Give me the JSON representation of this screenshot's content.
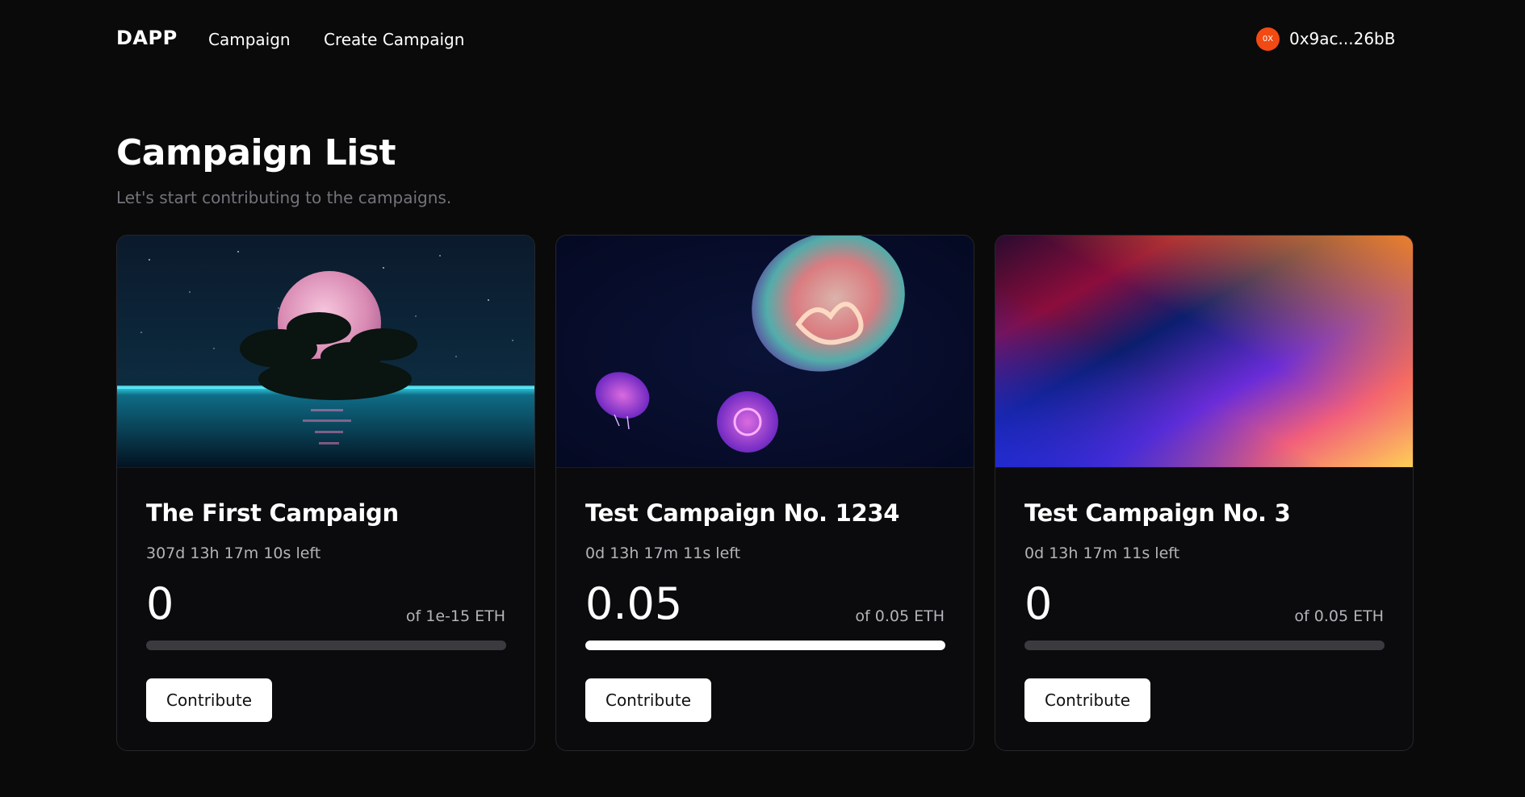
{
  "nav": {
    "brand": "DAPP",
    "links": [
      "Campaign",
      "Create Campaign"
    ],
    "wallet": {
      "avatar_text": "0X",
      "address": "0x9ac...26bB",
      "avatar_color": "#f24a12"
    }
  },
  "page": {
    "title": "Campaign List",
    "subtitle": "Let's start contributing to the campaigns."
  },
  "campaigns": [
    {
      "title": "The First Campaign",
      "time_left": "307d 13h 17m 10s left",
      "raised": "0",
      "goal": "of 1e-15 ETH",
      "progress": 0,
      "button": "Contribute",
      "image": "moon-island-image"
    },
    {
      "title": "Test Campaign No. 1234",
      "time_left": "0d 13h 17m 11s left",
      "raised": "0.05",
      "goal": "of 0.05 ETH",
      "progress": 1,
      "button": "Contribute",
      "image": "jellyfish-image"
    },
    {
      "title": "Test Campaign No. 3",
      "time_left": "0d 13h 17m 11s left",
      "raised": "0",
      "goal": "of 0.05 ETH",
      "progress": 0,
      "button": "Contribute",
      "image": "gradient-image"
    }
  ]
}
